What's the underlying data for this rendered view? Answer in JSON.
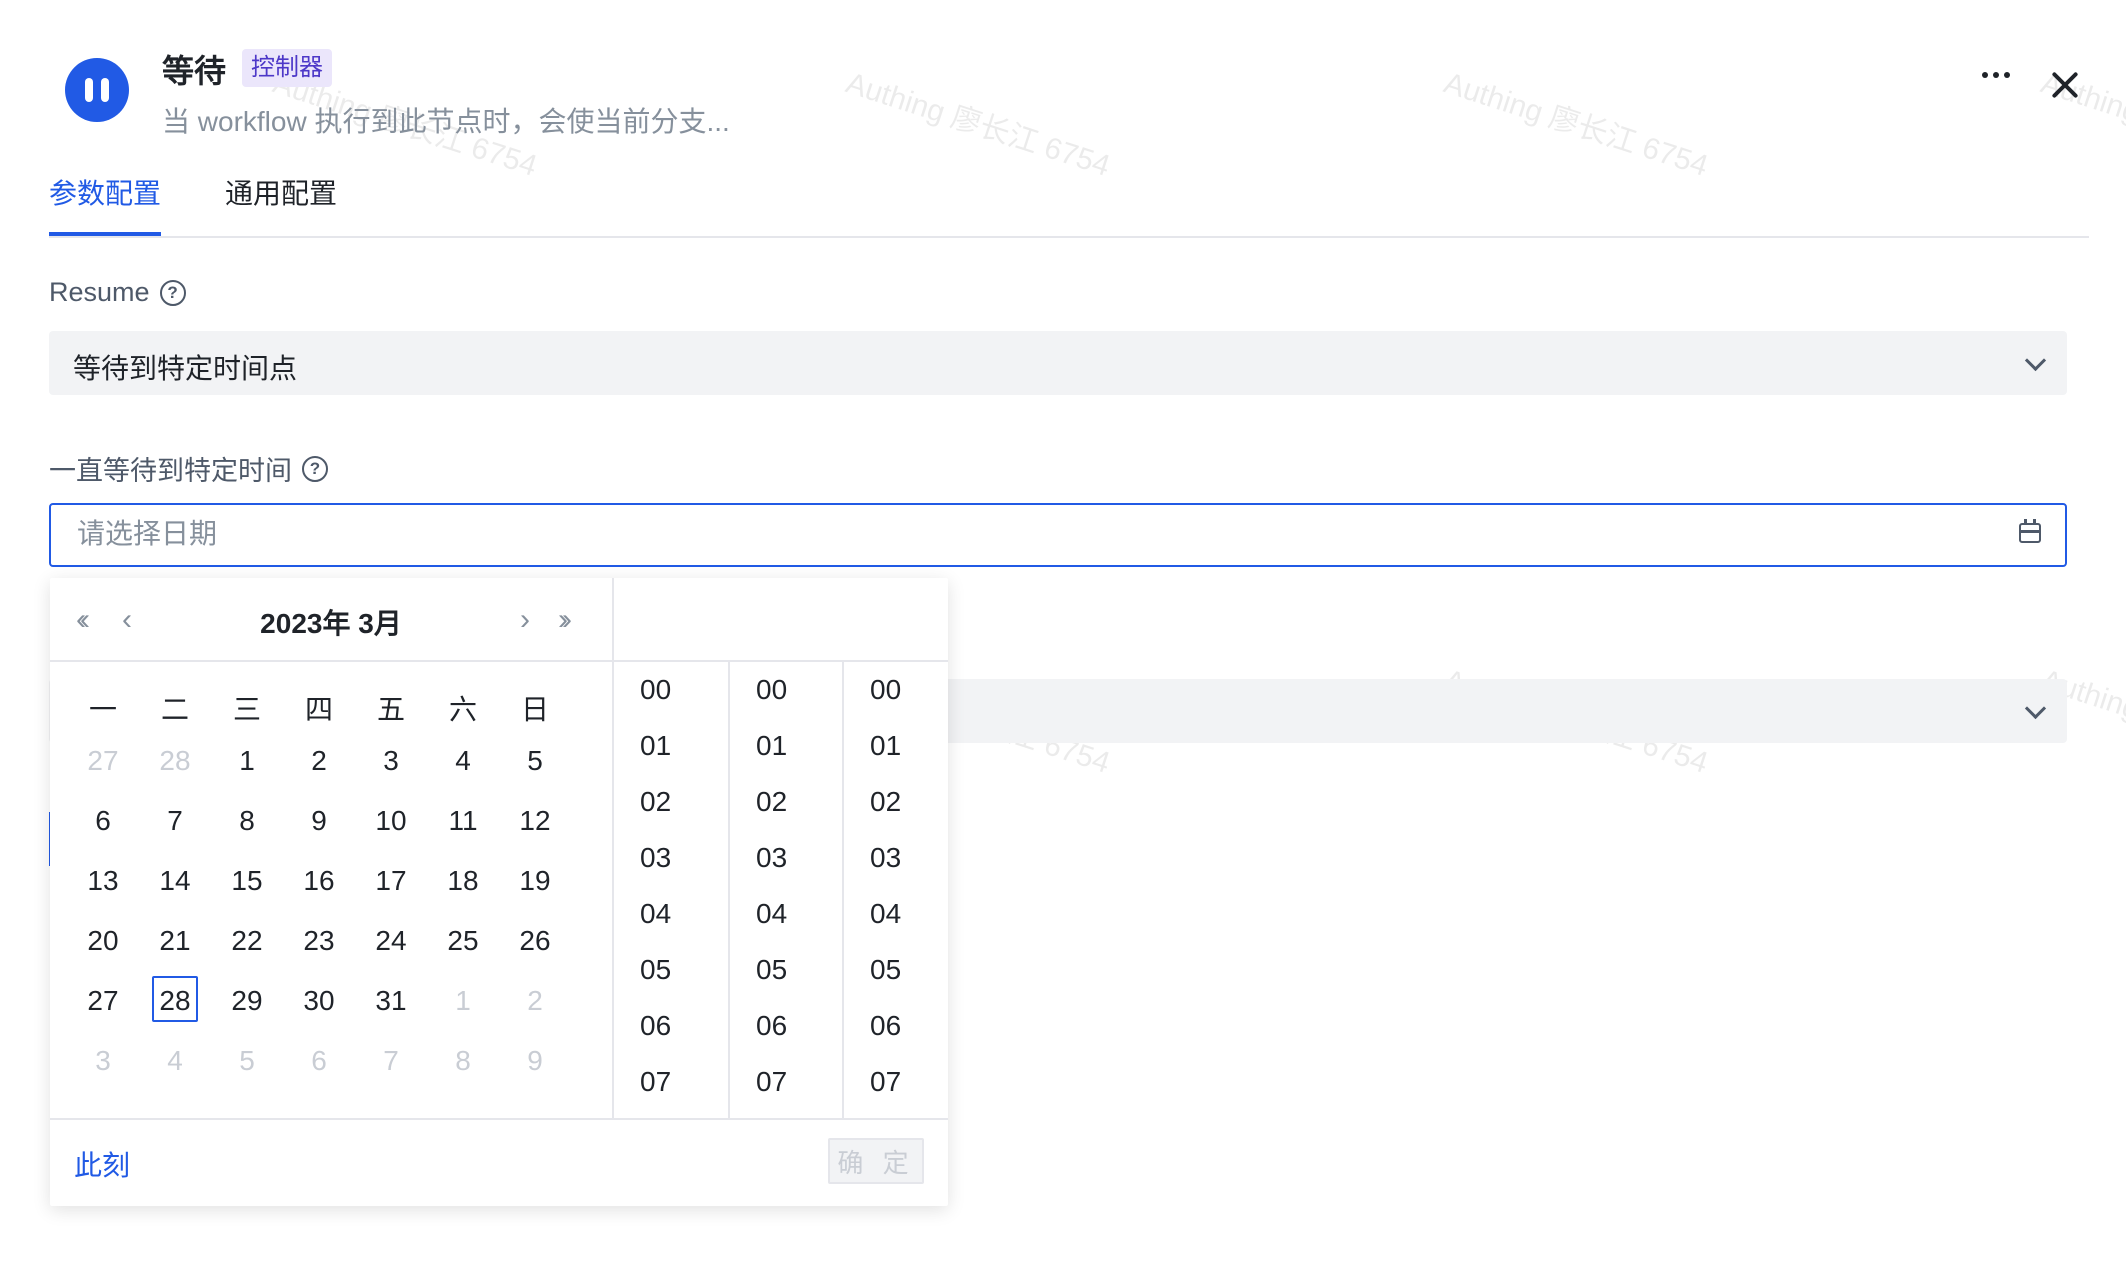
{
  "header": {
    "title": "等待",
    "tag": "控制器",
    "description": "当 workflow 执行到此节点时，会使当前分支..."
  },
  "tabs": [
    {
      "label": "参数配置",
      "active": true
    },
    {
      "label": "通用配置",
      "active": false
    }
  ],
  "form": {
    "resume_label": "Resume",
    "resume_value": "等待到特定时间点",
    "wait_label": "一直等待到特定时间",
    "date_placeholder": "请选择日期"
  },
  "picker": {
    "month_title": "2023年  3月",
    "weekdays": [
      "一",
      "二",
      "三",
      "四",
      "五",
      "六",
      "日"
    ],
    "days": [
      {
        "d": "27",
        "muted": true
      },
      {
        "d": "28",
        "muted": true
      },
      {
        "d": "1"
      },
      {
        "d": "2"
      },
      {
        "d": "3"
      },
      {
        "d": "4"
      },
      {
        "d": "5"
      },
      {
        "d": "6"
      },
      {
        "d": "7"
      },
      {
        "d": "8"
      },
      {
        "d": "9"
      },
      {
        "d": "10"
      },
      {
        "d": "11"
      },
      {
        "d": "12"
      },
      {
        "d": "13"
      },
      {
        "d": "14"
      },
      {
        "d": "15"
      },
      {
        "d": "16"
      },
      {
        "d": "17"
      },
      {
        "d": "18"
      },
      {
        "d": "19"
      },
      {
        "d": "20"
      },
      {
        "d": "21"
      },
      {
        "d": "22"
      },
      {
        "d": "23"
      },
      {
        "d": "24"
      },
      {
        "d": "25"
      },
      {
        "d": "26"
      },
      {
        "d": "27"
      },
      {
        "d": "28",
        "today": true
      },
      {
        "d": "29"
      },
      {
        "d": "30"
      },
      {
        "d": "31"
      },
      {
        "d": "1",
        "muted": true
      },
      {
        "d": "2",
        "muted": true
      },
      {
        "d": "3",
        "muted": true
      },
      {
        "d": "4",
        "muted": true
      },
      {
        "d": "5",
        "muted": true
      },
      {
        "d": "6",
        "muted": true
      },
      {
        "d": "7",
        "muted": true
      },
      {
        "d": "8",
        "muted": true
      },
      {
        "d": "9",
        "muted": true
      }
    ],
    "hours": [
      "00",
      "01",
      "02",
      "03",
      "04",
      "05",
      "06",
      "07"
    ],
    "minutes": [
      "00",
      "01",
      "02",
      "03",
      "04",
      "05",
      "06",
      "07"
    ],
    "seconds": [
      "00",
      "01",
      "02",
      "03",
      "04",
      "05",
      "06",
      "07"
    ],
    "now_label": "此刻",
    "ok_label": "确 定"
  },
  "watermark": "Authing 廖长江 6754",
  "colors": {
    "accent": "#215ae5",
    "tag_bg": "#ebe6fb",
    "tag_text": "#4d38c8"
  }
}
